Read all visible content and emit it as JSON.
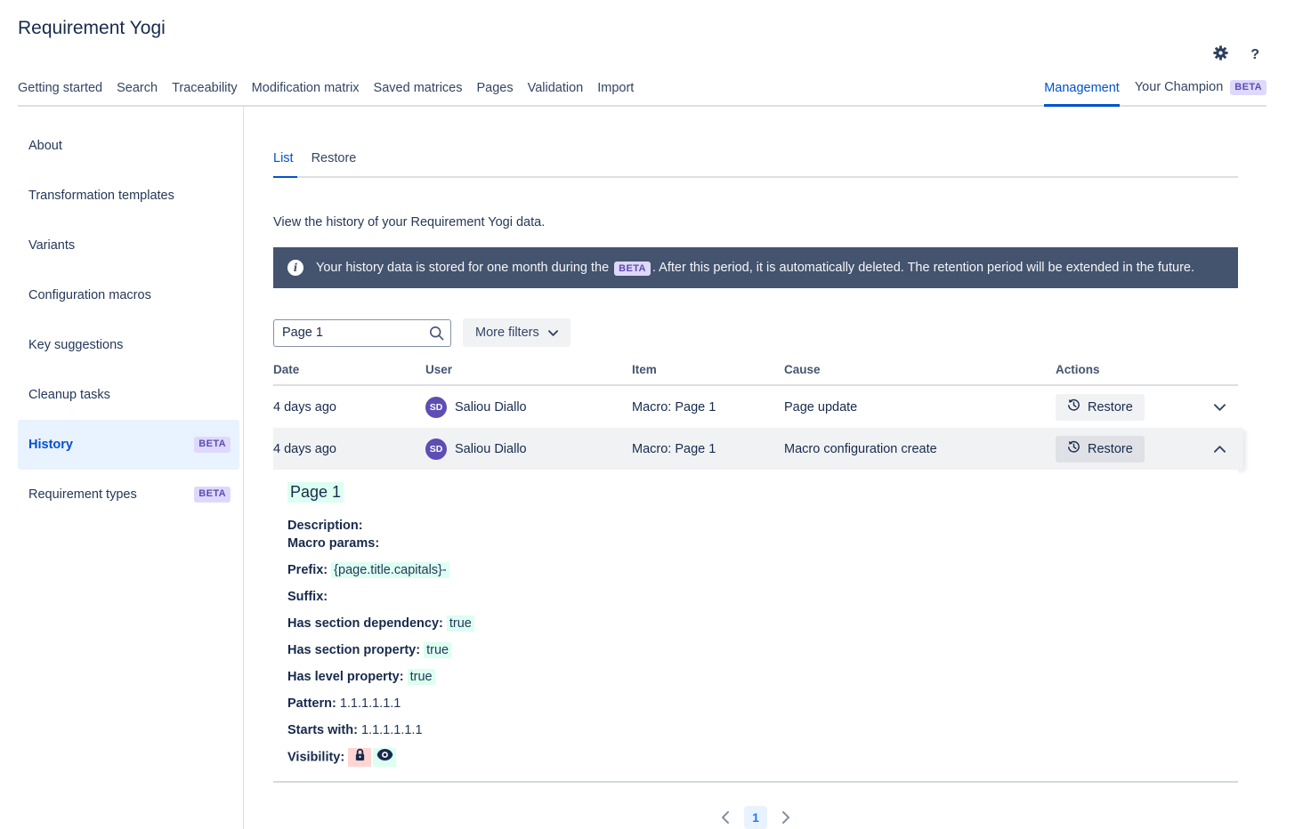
{
  "app": {
    "title": "Requirement Yogi"
  },
  "header": {
    "help_glyph": "?"
  },
  "nav": {
    "items": [
      {
        "label": "Getting started"
      },
      {
        "label": "Search"
      },
      {
        "label": "Traceability"
      },
      {
        "label": "Modification matrix"
      },
      {
        "label": "Saved matrices"
      },
      {
        "label": "Pages"
      },
      {
        "label": "Validation"
      },
      {
        "label": "Import"
      }
    ],
    "right": [
      {
        "label": "Management"
      },
      {
        "label": "Your Champion",
        "badge": "BETA"
      }
    ]
  },
  "sidebar": {
    "items": [
      {
        "label": "About"
      },
      {
        "label": "Transformation templates"
      },
      {
        "label": "Variants"
      },
      {
        "label": "Configuration macros"
      },
      {
        "label": "Key suggestions"
      },
      {
        "label": "Cleanup tasks"
      },
      {
        "label": "History",
        "badge": "BETA"
      },
      {
        "label": "Requirement types",
        "badge": "BETA"
      }
    ]
  },
  "tabs": [
    {
      "label": "List"
    },
    {
      "label": "Restore"
    }
  ],
  "main": {
    "intro": "View the history of your Requirement Yogi data."
  },
  "banner": {
    "info_glyph": "i",
    "text_before": "Your history data is stored for one month during the ",
    "badge": "BETA",
    "text_after": ". After this period, it is automatically deleted. The retention period will be extended in the future."
  },
  "filters": {
    "search_value": "Page 1",
    "more_label": "More filters"
  },
  "table": {
    "columns": [
      "Date",
      "User",
      "Item",
      "Cause",
      "Actions"
    ],
    "rows": [
      {
        "date": "4 days ago",
        "user_initials": "SD",
        "user_name": "Saliou Diallo",
        "item": "Macro: Page 1",
        "cause": "Page update",
        "action": "Restore"
      },
      {
        "date": "4 days ago",
        "user_initials": "SD",
        "user_name": "Saliou Diallo",
        "item": "Macro: Page 1",
        "cause": "Macro configuration create",
        "action": "Restore"
      }
    ]
  },
  "details": {
    "title": "Page 1",
    "description_label": "Description:",
    "macro_params_label": "Macro params:",
    "prefix_label": "Prefix:",
    "prefix_value": "{page.title.capitals}-",
    "suffix_label": "Suffix:",
    "has_section_dependency_label": "Has section dependency:",
    "has_section_dependency_value": "true",
    "has_section_property_label": "Has section property:",
    "has_section_property_value": "true",
    "has_level_property_label": "Has level property:",
    "has_level_property_value": "true",
    "pattern_label": "Pattern:",
    "pattern_value": "1.1.1.1.1.1",
    "starts_with_label": "Starts with:",
    "starts_with_value": "1.1.1.1.1.1",
    "visibility_label": "Visibility:"
  },
  "pagination": {
    "current_page": "1"
  },
  "colors": {
    "accent_blue": "#0052CC",
    "navy_text": "#172B4D",
    "banner_bg": "#44546F",
    "beta_badge_bg": "#DFD8FD",
    "beta_badge_text": "#5E4DB2",
    "avatar_bg": "#5E4DB2",
    "added_highlight": "#DCFFF1",
    "removed_highlight": "#FFD5D2",
    "row_highlight": "#F1F2F4"
  }
}
